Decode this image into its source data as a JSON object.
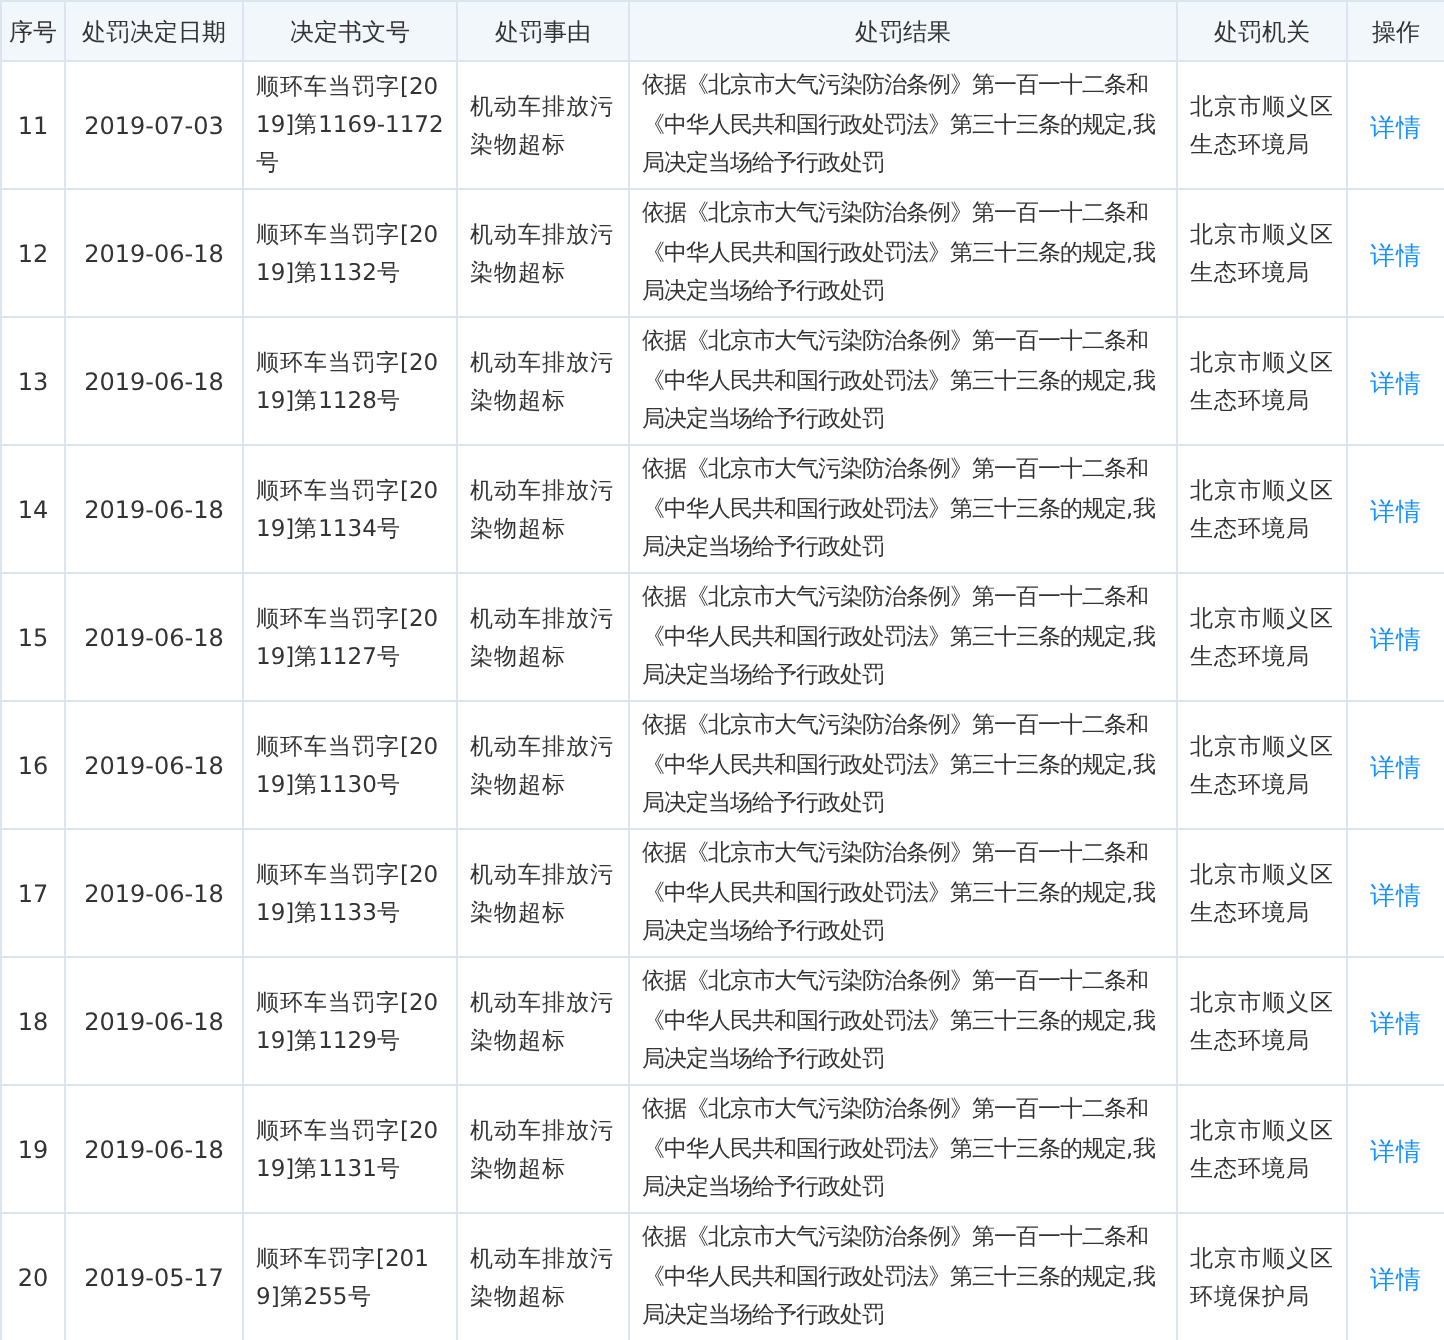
{
  "table": {
    "columns": [
      "序号",
      "处罚决定日期",
      "决定书文号",
      "处罚事由",
      "处罚结果",
      "处罚机关",
      "操作"
    ],
    "rows": [
      {
        "no": "11",
        "date": "2019-07-03",
        "doc": "顺环车当罚字[2019]第1169-1172号",
        "reason": "机动车排放污染物超标",
        "result": "依据《北京市大气污染防治条例》第一百一十二条和《中华人民共和国行政处罚法》第三十三条的规定,我局决定当场给予行政处罚",
        "agency": "北京市顺义区生态环境局",
        "action": "详情"
      },
      {
        "no": "12",
        "date": "2019-06-18",
        "doc": "顺环车当罚字[2019]第1132号",
        "reason": "机动车排放污染物超标",
        "result": "依据《北京市大气污染防治条例》第一百一十二条和《中华人民共和国行政处罚法》第三十三条的规定,我局决定当场给予行政处罚",
        "agency": "北京市顺义区生态环境局",
        "action": "详情"
      },
      {
        "no": "13",
        "date": "2019-06-18",
        "doc": "顺环车当罚字[2019]第1128号",
        "reason": "机动车排放污染物超标",
        "result": "依据《北京市大气污染防治条例》第一百一十二条和《中华人民共和国行政处罚法》第三十三条的规定,我局决定当场给予行政处罚",
        "agency": "北京市顺义区生态环境局",
        "action": "详情"
      },
      {
        "no": "14",
        "date": "2019-06-18",
        "doc": "顺环车当罚字[2019]第1134号",
        "reason": "机动车排放污染物超标",
        "result": "依据《北京市大气污染防治条例》第一百一十二条和《中华人民共和国行政处罚法》第三十三条的规定,我局决定当场给予行政处罚",
        "agency": "北京市顺义区生态环境局",
        "action": "详情"
      },
      {
        "no": "15",
        "date": "2019-06-18",
        "doc": "顺环车当罚字[2019]第1127号",
        "reason": "机动车排放污染物超标",
        "result": "依据《北京市大气污染防治条例》第一百一十二条和《中华人民共和国行政处罚法》第三十三条的规定,我局决定当场给予行政处罚",
        "agency": "北京市顺义区生态环境局",
        "action": "详情"
      },
      {
        "no": "16",
        "date": "2019-06-18",
        "doc": "顺环车当罚字[2019]第1130号",
        "reason": "机动车排放污染物超标",
        "result": "依据《北京市大气污染防治条例》第一百一十二条和《中华人民共和国行政处罚法》第三十三条的规定,我局决定当场给予行政处罚",
        "agency": "北京市顺义区生态环境局",
        "action": "详情"
      },
      {
        "no": "17",
        "date": "2019-06-18",
        "doc": "顺环车当罚字[2019]第1133号",
        "reason": "机动车排放污染物超标",
        "result": "依据《北京市大气污染防治条例》第一百一十二条和《中华人民共和国行政处罚法》第三十三条的规定,我局决定当场给予行政处罚",
        "agency": "北京市顺义区生态环境局",
        "action": "详情"
      },
      {
        "no": "18",
        "date": "2019-06-18",
        "doc": "顺环车当罚字[2019]第1129号",
        "reason": "机动车排放污染物超标",
        "result": "依据《北京市大气污染防治条例》第一百一十二条和《中华人民共和国行政处罚法》第三十三条的规定,我局决定当场给予行政处罚",
        "agency": "北京市顺义区生态环境局",
        "action": "详情"
      },
      {
        "no": "19",
        "date": "2019-06-18",
        "doc": "顺环车当罚字[2019]第1131号",
        "reason": "机动车排放污染物超标",
        "result": "依据《北京市大气污染防治条例》第一百一十二条和《中华人民共和国行政处罚法》第三十三条的规定,我局决定当场给予行政处罚",
        "agency": "北京市顺义区生态环境局",
        "action": "详情"
      },
      {
        "no": "20",
        "date": "2019-05-17",
        "doc": "顺环车罚字[2019]第255号",
        "reason": "机动车排放污染物超标",
        "result": "依据《北京市大气污染防治条例》第一百一十二条和《中华人民共和国行政处罚法》第三十三条的规定,我局决定当场给予行政处罚",
        "agency": "北京市顺义区环境保护局",
        "action": "详情"
      }
    ]
  }
}
